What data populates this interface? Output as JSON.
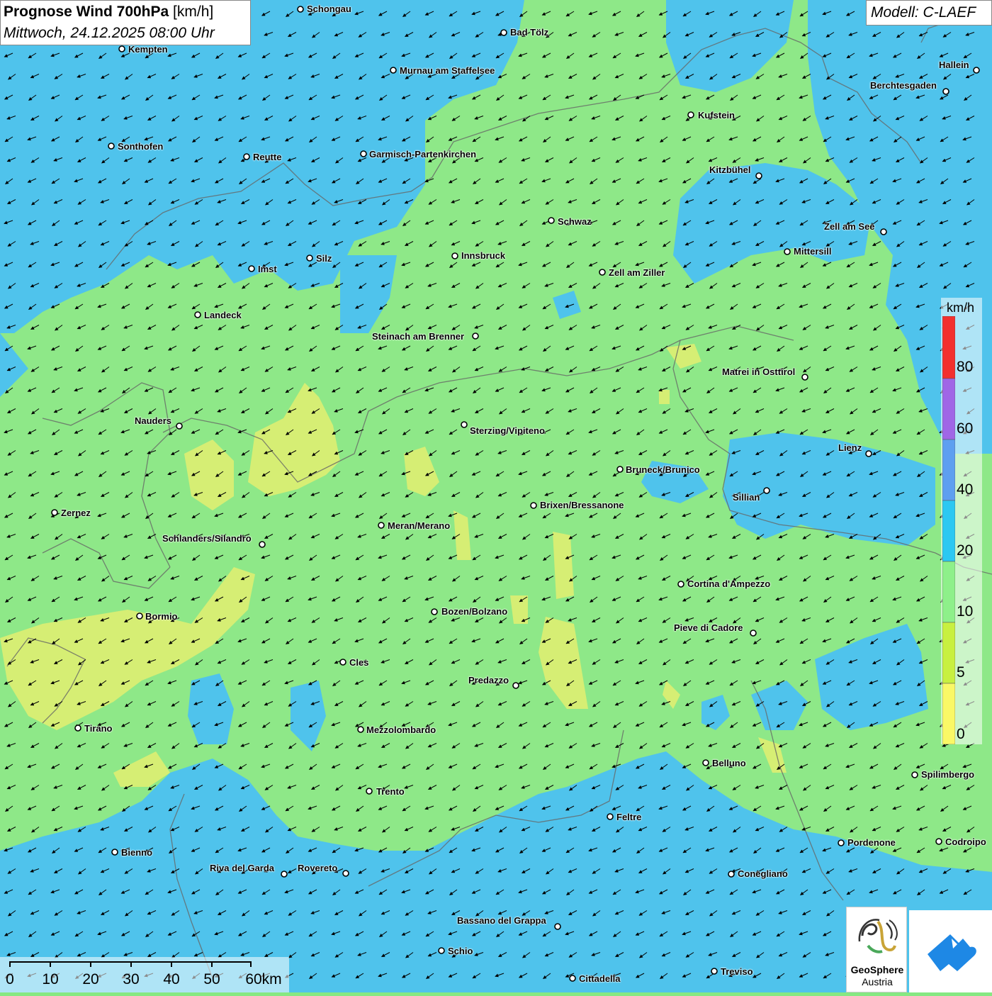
{
  "title": {
    "main": "Prognose Wind 700hPa",
    "unit": "[km/h]",
    "date": "Mittwoch, 24.12.2025 08:00 Uhr"
  },
  "model": "Modell: C-LAEF",
  "legend": {
    "unit": "km/h",
    "labels": [
      "80",
      "60",
      "40",
      "20",
      "10",
      "5",
      "0"
    ],
    "colors": [
      "#f2302e",
      "#a066e6",
      "#5e9ff0",
      "#2cc8f2",
      "#8ef08a",
      "#c8f040",
      "#faf866"
    ]
  },
  "colors": {
    "calm_yellow": "#d8ee78",
    "light_green": "#8ee888",
    "blue_20": "#4ec4ec",
    "arrow": "#000000"
  },
  "wind": {
    "direction": "from east-northeast, arrows pointing west-southwest"
  },
  "cities": [
    {
      "name": "Schongau"
    },
    {
      "name": "Kempten"
    },
    {
      "name": "Bad Tölz"
    },
    {
      "name": "Murnau am Staffelsee"
    },
    {
      "name": "Hallein"
    },
    {
      "name": "Berchtesgaden"
    },
    {
      "name": "Kufstein"
    },
    {
      "name": "Sonthofen"
    },
    {
      "name": "Reutte"
    },
    {
      "name": "Garmisch-Partenkirchen"
    },
    {
      "name": "Kitzbühel"
    },
    {
      "name": "Schwaz"
    },
    {
      "name": "Zell am See"
    },
    {
      "name": "Mittersill"
    },
    {
      "name": "Silz"
    },
    {
      "name": "Innsbruck"
    },
    {
      "name": "Imst"
    },
    {
      "name": "Zell am Ziller"
    },
    {
      "name": "Landeck"
    },
    {
      "name": "Steinach am Brenner"
    },
    {
      "name": "Matrei in Osttirol"
    },
    {
      "name": "Nauders"
    },
    {
      "name": "Sterzing/Vipiteno"
    },
    {
      "name": "Lienz"
    },
    {
      "name": "Bruneck/Brunico"
    },
    {
      "name": "Sillian"
    },
    {
      "name": "Brixen/Bressanone"
    },
    {
      "name": "Zernez"
    },
    {
      "name": "Meran/Merano"
    },
    {
      "name": "Schlanders/Silandro"
    },
    {
      "name": "Cortina d'Ampezzo"
    },
    {
      "name": "Bormio"
    },
    {
      "name": "Bozen/Bolzano"
    },
    {
      "name": "Pieve di Cadore"
    },
    {
      "name": "Cles"
    },
    {
      "name": "Predazzo"
    },
    {
      "name": "Tirano"
    },
    {
      "name": "Mezzolombardo"
    },
    {
      "name": "Belluno"
    },
    {
      "name": "Spilimbergo"
    },
    {
      "name": "Trento"
    },
    {
      "name": "Feltre"
    },
    {
      "name": "Pordenone"
    },
    {
      "name": "Codroipo"
    },
    {
      "name": "Bienno"
    },
    {
      "name": "Riva del Garda"
    },
    {
      "name": "Rovereto"
    },
    {
      "name": "Conegliano"
    },
    {
      "name": "Bassano del Grappa"
    },
    {
      "name": "Schio"
    },
    {
      "name": "Treviso"
    },
    {
      "name": "Cittadella"
    }
  ],
  "scale": {
    "labels": [
      "0",
      "10",
      "20",
      "30",
      "40",
      "50",
      "60km"
    ]
  },
  "logos": {
    "geosphere_name": "GeoSphere",
    "geosphere_country": "Austria"
  }
}
